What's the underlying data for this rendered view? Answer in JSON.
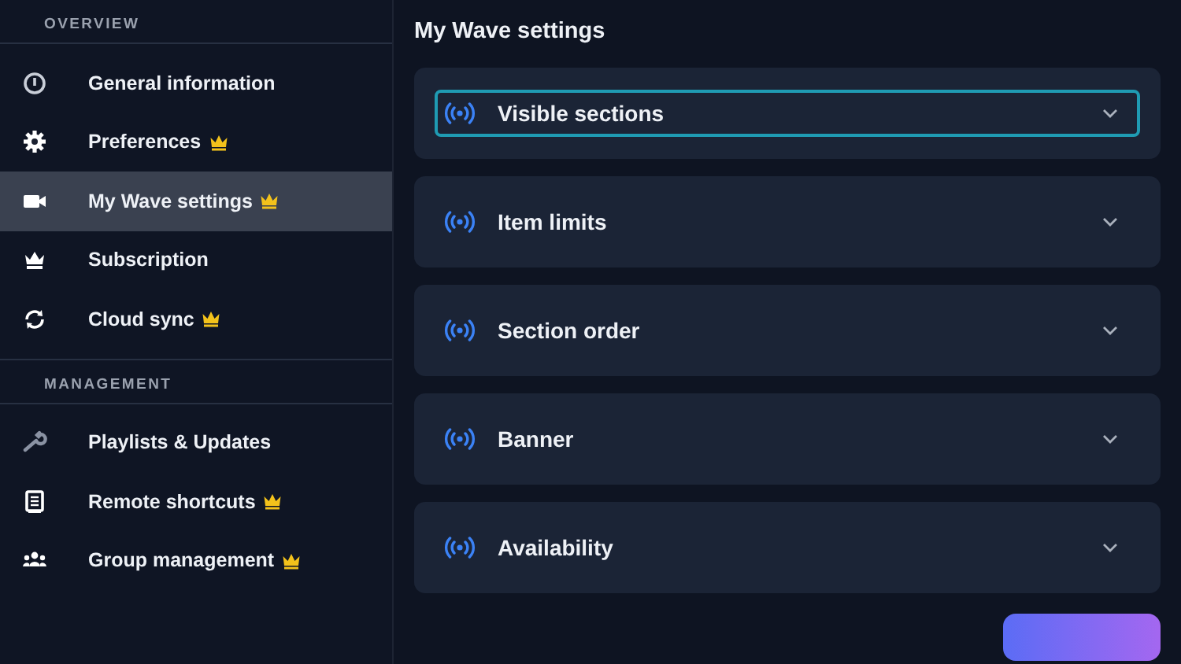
{
  "sidebar": {
    "groups": [
      {
        "heading": "OVERVIEW",
        "items": [
          {
            "kind": "info",
            "label": "General information",
            "premium": false,
            "selected": false
          },
          {
            "kind": "gear",
            "label": "Preferences",
            "premium": true,
            "selected": false
          },
          {
            "kind": "camera",
            "label": "My Wave settings",
            "premium": true,
            "selected": true
          },
          {
            "kind": "crown",
            "label": "Subscription",
            "premium": false,
            "selected": false
          },
          {
            "kind": "sync",
            "label": "Cloud sync",
            "premium": true,
            "selected": false
          }
        ]
      },
      {
        "heading": "MANAGEMENT",
        "items": [
          {
            "kind": "wrench",
            "label": "Playlists & Updates",
            "premium": false,
            "selected": false
          },
          {
            "kind": "clipboard",
            "label": "Remote shortcuts",
            "premium": true,
            "selected": false
          },
          {
            "kind": "group",
            "label": "Group management",
            "premium": true,
            "selected": false
          }
        ]
      }
    ]
  },
  "page_title": "My Wave settings",
  "sections": [
    {
      "label": "Visible sections",
      "focused": true
    },
    {
      "label": "Item limits",
      "focused": false
    },
    {
      "label": "Section order",
      "focused": false
    },
    {
      "label": "Banner",
      "focused": false
    },
    {
      "label": "Availability",
      "focused": false
    }
  ]
}
